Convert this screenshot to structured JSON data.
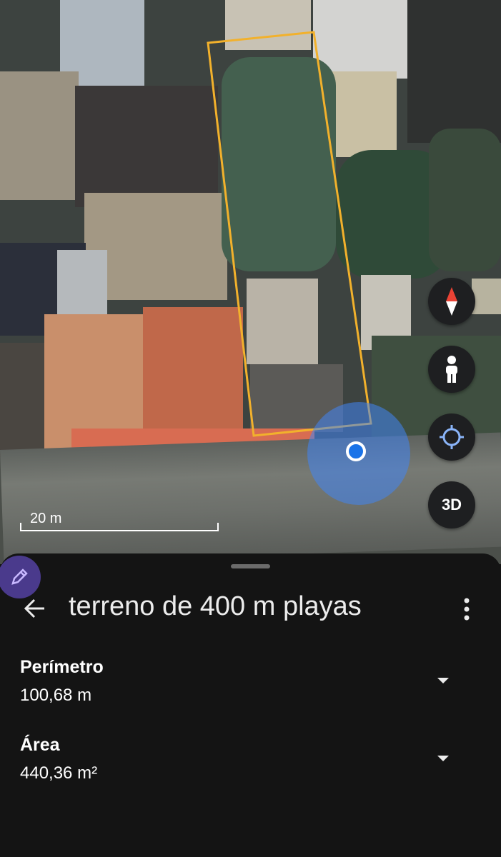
{
  "map": {
    "scale_label": "20 m",
    "controls": {
      "compass_icon": "compass-icon",
      "streetview_icon": "pegman-icon",
      "location_icon": "my-location-icon",
      "three_d_label": "3D"
    }
  },
  "sheet": {
    "title": "terreno de 400 m playas",
    "measurements": [
      {
        "label": "Perímetro",
        "value": "100,68 m"
      },
      {
        "label": "Área",
        "value": "440,36 m²"
      }
    ]
  },
  "colors": {
    "parcel_outline": "#f2b12c",
    "location_blue": "#1a73e8",
    "sheet_bg": "#141414",
    "edit_fab": "#4a3a8c"
  }
}
